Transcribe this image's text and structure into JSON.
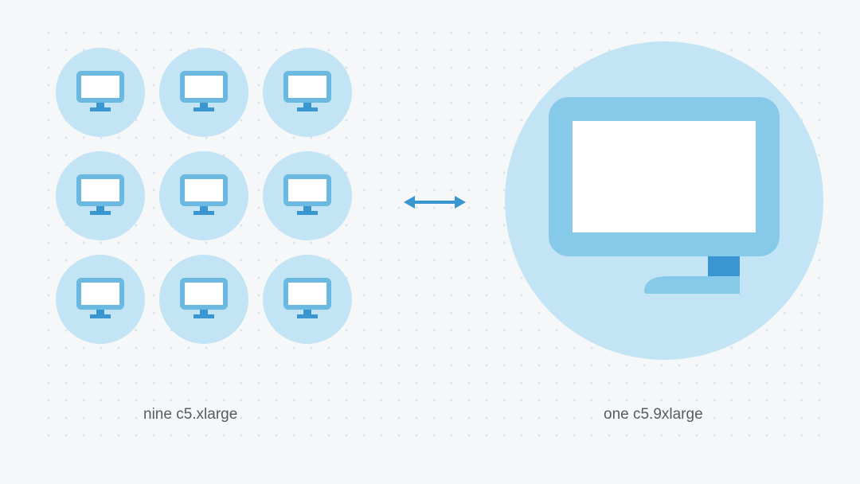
{
  "diagram": {
    "left_label": "nine c5.xlarge",
    "right_label": "one c5.9xlarge",
    "left_count": 9,
    "right_count": 1,
    "equivalence": "bidirectional"
  },
  "colors": {
    "circle_fill": "#c2e4f4",
    "monitor_stroke": "#6bb8e0",
    "monitor_fill": "#ffffff",
    "monitor_stand": "#3a96d0",
    "arrow": "#3a96d0",
    "text": "#555c63",
    "bg": "#f5f7f9",
    "dot": "#d3dbe3"
  },
  "icons": {
    "small_monitor": "monitor-icon",
    "big_monitor": "monitor-icon",
    "arrow": "bidirectional-arrow-icon"
  }
}
